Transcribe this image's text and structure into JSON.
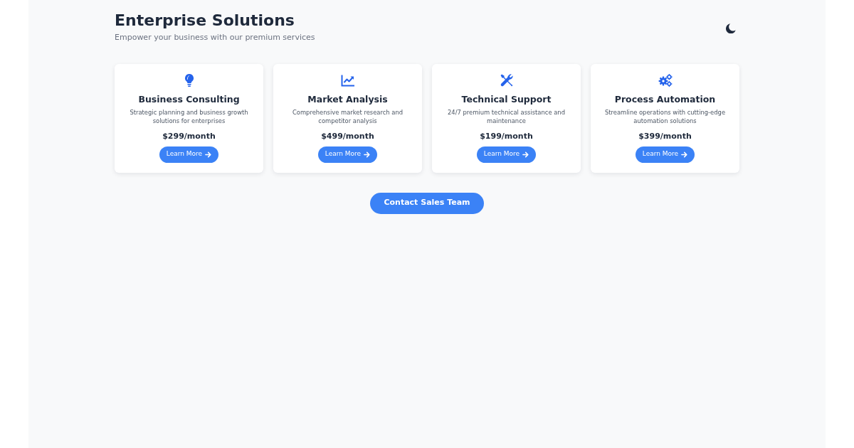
{
  "header": {
    "title": "Enterprise Solutions",
    "subtitle": "Empower your business with our premium services"
  },
  "services": [
    {
      "kind": "lightbulb",
      "title": "Business Consulting",
      "description": "Strategic planning and business growth solutions for enterprises",
      "price": "$299/month",
      "button": "Learn More"
    },
    {
      "kind": "chart",
      "title": "Market Analysis",
      "description": "Comprehensive market research and competitor analysis",
      "price": "$499/month",
      "button": "Learn More"
    },
    {
      "kind": "tools",
      "title": "Technical Support",
      "description": "24/7 premium technical assistance and maintenance",
      "price": "$199/month",
      "button": "Learn More"
    },
    {
      "kind": "gears",
      "title": "Process Automation",
      "description": "Streamline operations with cutting-edge automation solutions",
      "price": "$399/month",
      "button": "Learn More"
    }
  ],
  "contact_button": "Contact Sales Team"
}
